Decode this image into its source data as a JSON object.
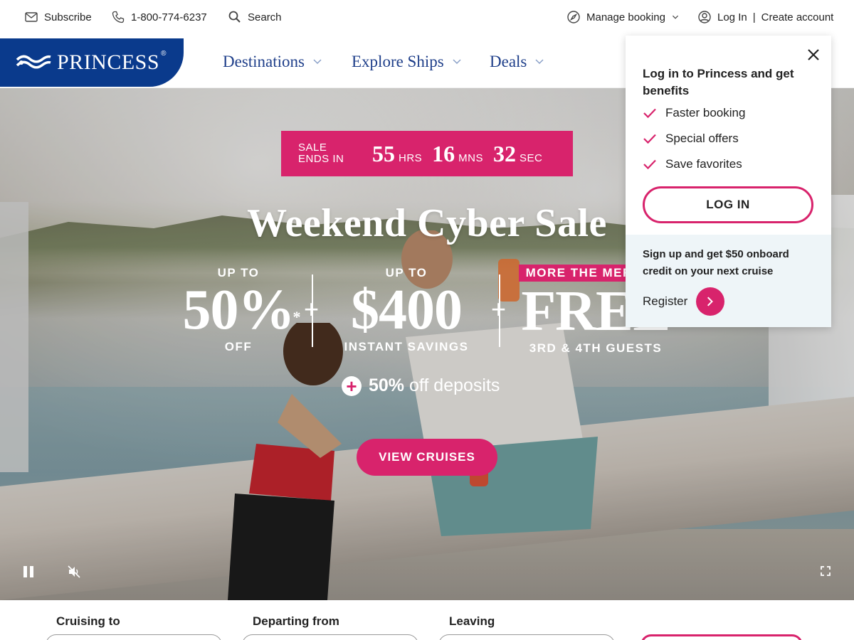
{
  "utility_bar": {
    "subscribe": "Subscribe",
    "phone": "1-800-774-6237",
    "search": "Search",
    "manage_booking": "Manage booking",
    "login": "Log In",
    "separator": "|",
    "create_account": "Create account"
  },
  "header": {
    "logo_text": "PRINCESS",
    "logo_mark": "®",
    "nav": [
      {
        "label": "Destinations"
      },
      {
        "label": "Explore Ships"
      },
      {
        "label": "Deals"
      }
    ]
  },
  "hero": {
    "countdown": {
      "label_line1": "SALE",
      "label_line2": "ENDS IN",
      "hours": "55",
      "hours_unit": "HRS",
      "minutes": "16",
      "minutes_unit": "MNS",
      "seconds": "32",
      "seconds_unit": "SEC"
    },
    "title": "Weekend Cyber Sale",
    "offers": [
      {
        "top": "UP TO",
        "big": "50%",
        "mark": "*",
        "bottom": "OFF"
      },
      {
        "top": "UP TO",
        "big": "$400",
        "bottom": "INSTANT SAVINGS"
      },
      {
        "top": "MORE THE MERRIER",
        "big": "FREE",
        "bottom": "3RD & 4TH GUESTS"
      }
    ],
    "plus": "+",
    "deposits_bold": "50%",
    "deposits_text": "off deposits",
    "cta": "VIEW CRUISES"
  },
  "search": {
    "cruising_to": "Cruising to",
    "departing_from": "Departing from",
    "leaving": "Leaving"
  },
  "login_popover": {
    "title": "Log in to Princess and get benefits",
    "benefits": [
      "Faster booking",
      "Special offers",
      "Save favorites"
    ],
    "login_button": "LOG IN",
    "promo": "Sign up and get $50 onboard credit on your next cruise",
    "register": "Register"
  },
  "colors": {
    "brand_blue": "#0a3a8c",
    "nav_blue": "#1f3f8a",
    "accent_pink": "#d8236c"
  }
}
